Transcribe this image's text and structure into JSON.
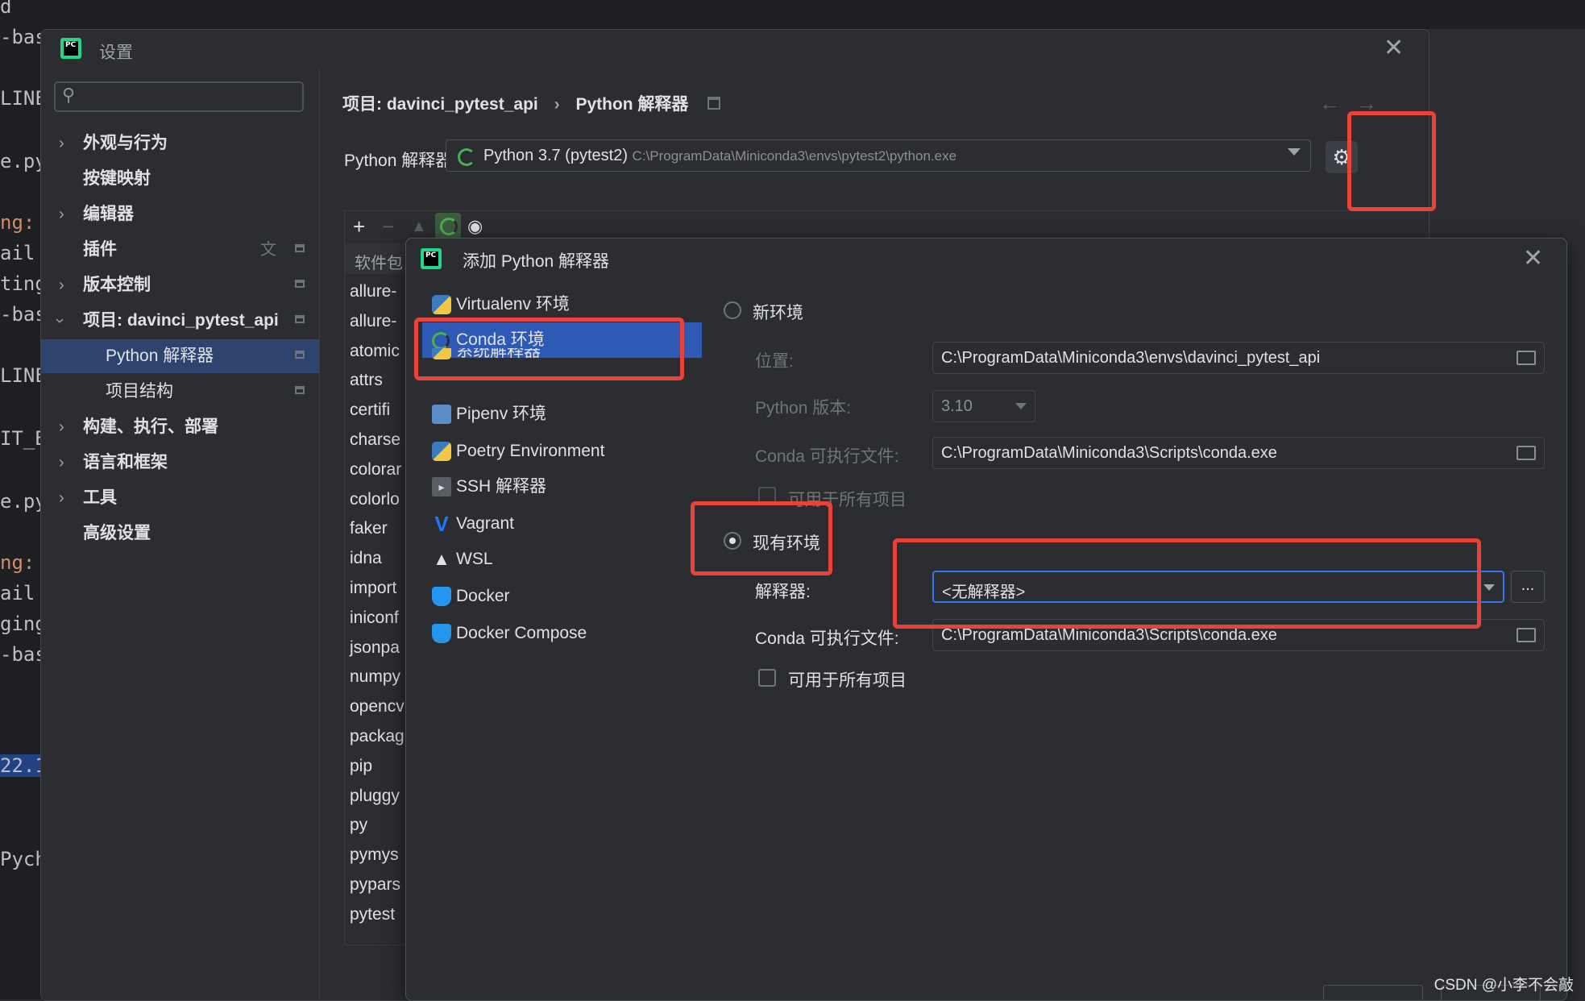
{
  "background_editor": {
    "lines": [
      "d",
      "-bas",
      "LINE",
      "e.py",
      "ng:",
      "ail",
      "ting",
      "-bas",
      "LINE",
      "IT_B",
      "e.py",
      "ng:",
      "ail",
      "ging",
      "-bas",
      "22.1",
      "Pych"
    ]
  },
  "settings": {
    "title": "设置",
    "search_placeholder": "",
    "tree": [
      {
        "label": "外观与行为",
        "expandable": true
      },
      {
        "label": "按键映射",
        "expandable": false
      },
      {
        "label": "编辑器",
        "expandable": true
      },
      {
        "label": "插件",
        "expandable": false
      },
      {
        "label": "版本控制",
        "expandable": true
      },
      {
        "label": "项目: davinci_pytest_api",
        "expandable": true,
        "expanded": true
      },
      {
        "label": "Python 解释器",
        "child": true,
        "active": true
      },
      {
        "label": "项目结构",
        "child": true
      },
      {
        "label": "构建、执行、部署",
        "expandable": true
      },
      {
        "label": "语言和框架",
        "expandable": true
      },
      {
        "label": "工具",
        "expandable": true
      },
      {
        "label": "高级设置",
        "expandable": false
      }
    ],
    "breadcrumb": {
      "project": "项目: davinci_pytest_api",
      "separator": "›",
      "page": "Python 解释器"
    },
    "interpreter_label": "Python 解释器:",
    "interpreter_value": "Python 3.7 (pytest2)",
    "interpreter_path": "C:\\ProgramData\\Miniconda3\\envs\\pytest2\\python.exe",
    "packages_header": "软件包",
    "packages": [
      "allure-",
      "allure-",
      "atomic",
      "attrs",
      "certifi",
      "charse",
      "colorar",
      "colorlo",
      "faker",
      "idna",
      "import",
      "iniconf",
      "jsonpa",
      "numpy",
      "opencv",
      "packag",
      "pip",
      "pluggy",
      "py",
      "pymys",
      "pypars",
      "pytest"
    ]
  },
  "dialog": {
    "title": "添加 Python 解释器",
    "env_types": [
      {
        "label": "Virtualenv 环境",
        "icon": "python-icon"
      },
      {
        "label": "Conda 环境",
        "icon": "conda-icon",
        "selected": true
      },
      {
        "label": "系统解释器",
        "icon": "python-icon"
      },
      {
        "label": "Pipenv 环境",
        "icon": "pipenv-icon"
      },
      {
        "label": "Poetry Environment",
        "icon": "python-icon"
      },
      {
        "label": "SSH 解释器",
        "icon": "ssh-icon"
      },
      {
        "label": "Vagrant",
        "icon": "vagrant-icon"
      },
      {
        "label": "WSL",
        "icon": "linux-icon"
      },
      {
        "label": "Docker",
        "icon": "docker-icon"
      },
      {
        "label": "Docker Compose",
        "icon": "docker-icon"
      }
    ],
    "new_env": {
      "radio_label": "新环境",
      "location_label": "位置:",
      "location_value": "C:\\ProgramData\\Miniconda3\\envs\\davinci_pytest_api",
      "python_version_label": "Python 版本:",
      "python_version_value": "3.10",
      "conda_exe_label": "Conda 可执行文件:",
      "conda_exe_value": "C:\\ProgramData\\Miniconda3\\Scripts\\conda.exe",
      "all_projects_label": "可用于所有项目"
    },
    "existing_env": {
      "radio_label": "现有环境",
      "interpreter_label": "解释器:",
      "interpreter_value": "<无解释器>",
      "browse_label": "...",
      "conda_exe_label": "Conda 可执行文件:",
      "conda_exe_value": "C:\\ProgramData\\Miniconda3\\Scripts\\conda.exe",
      "all_projects_label": "可用于所有项目"
    }
  },
  "watermark": "CSDN @小李不会敲",
  "colors": {
    "highlight": "#e8433a",
    "selection": "#2e5ab6",
    "accent": "#3574f0"
  }
}
